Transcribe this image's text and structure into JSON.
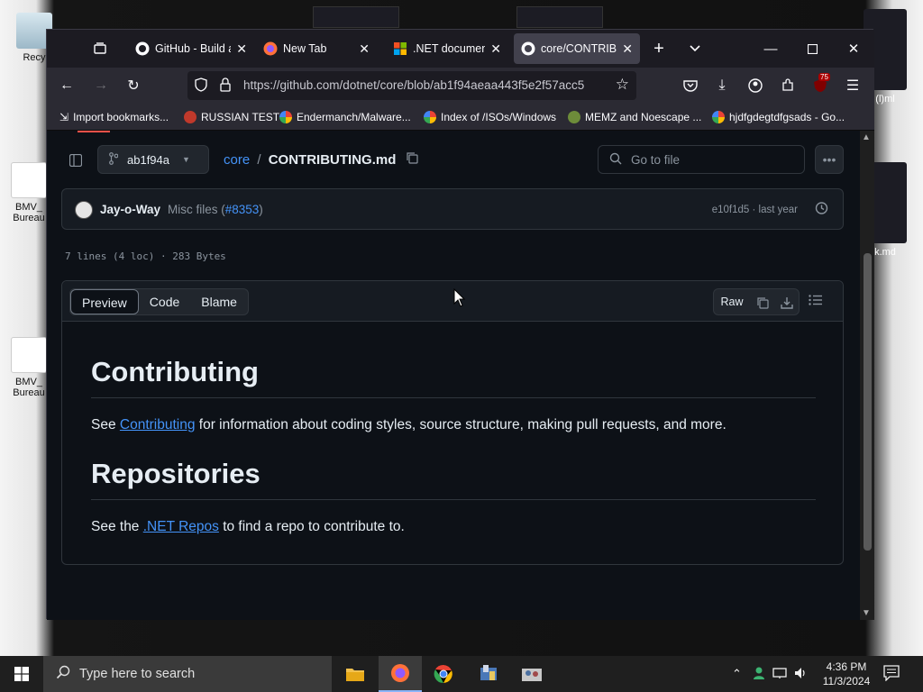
{
  "desktop": {
    "icons": [
      {
        "label": "Recy"
      },
      {
        "label": "BMV_ Bureau"
      },
      {
        "label": "BMV_ Bureau"
      },
      {
        "label": "(l)ml"
      },
      {
        "label": "k.md"
      }
    ]
  },
  "browser": {
    "tabs": [
      {
        "title": "GitHub - Build a",
        "favicon": "github-icon"
      },
      {
        "title": "New Tab",
        "favicon": "firefox-icon"
      },
      {
        "title": ".NET document",
        "favicon": "microsoft-icon"
      },
      {
        "title": "core/CONTRIBU",
        "favicon": "github-icon",
        "active": true
      }
    ],
    "url": "https://github.com/dotnet/core/blob/ab1f94aeaa443f5e2f57acc5",
    "extension_badge": "75",
    "bookmarks": [
      {
        "label": "Import bookmarks..."
      },
      {
        "label": "RUSSIAN TEST"
      },
      {
        "label": "Endermanch/Malware..."
      },
      {
        "label": "Index of /ISOs/Windows"
      },
      {
        "label": "MEMZ and Noescape ..."
      },
      {
        "label": "hjdfgdegtdfgsads - Go..."
      }
    ]
  },
  "github": {
    "branch": "ab1f94a",
    "breadcrumb_repo": "core",
    "breadcrumb_sep": "/",
    "breadcrumb_file": "CONTRIBUTING.md",
    "goto_file_placeholder": "Go to file",
    "commit": {
      "author": "Jay-o-Way",
      "message": "Misc files (",
      "pr": "#8353",
      "message_end": ")",
      "hash_time": "e10f1d5 · last year"
    },
    "file_info": "7 lines (4 loc) · 283 Bytes",
    "view_tabs": {
      "preview": "Preview",
      "code": "Code",
      "blame": "Blame"
    },
    "raw_label": "Raw",
    "markdown": {
      "h1_contributing": "Contributing",
      "p1_pre": "See ",
      "p1_link": "Contributing",
      "p1_post": " for information about coding styles, source structure, making pull requests, and more.",
      "h1_repositories": "Repositories",
      "p2_pre": "See the ",
      "p2_link": ".NET Repos",
      "p2_post": " to find a repo to contribute to."
    }
  },
  "taskbar": {
    "search_placeholder": "Type here to search",
    "time": "4:36 PM",
    "date": "11/3/2024"
  },
  "colors": {
    "github_bg": "#0d1117",
    "link": "#4493f8",
    "firefox_chrome": "#2b2a33"
  }
}
